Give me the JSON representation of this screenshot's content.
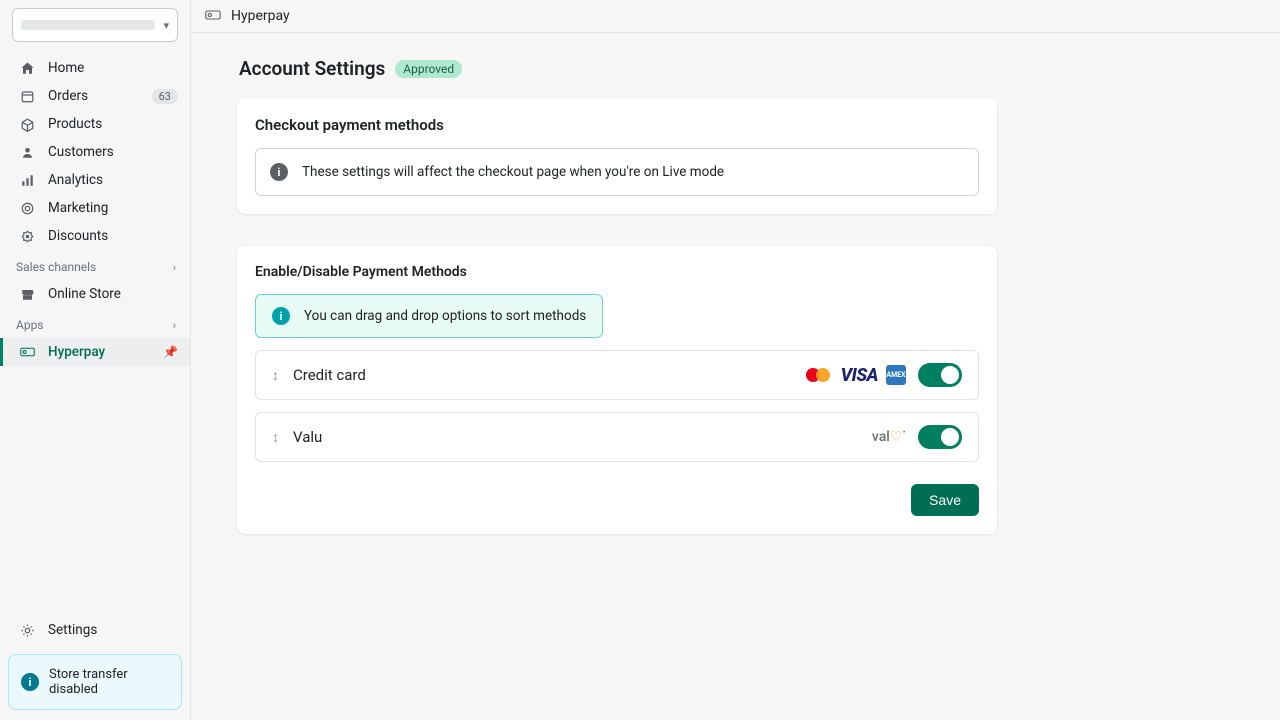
{
  "sidebar": {
    "items": [
      {
        "label": "Home"
      },
      {
        "label": "Orders",
        "badge": "63"
      },
      {
        "label": "Products"
      },
      {
        "label": "Customers"
      },
      {
        "label": "Analytics"
      },
      {
        "label": "Marketing"
      },
      {
        "label": "Discounts"
      }
    ],
    "sales_channels_label": "Sales channels",
    "online_store_label": "Online Store",
    "apps_label": "Apps",
    "app_item_label": "Hyperpay",
    "settings_label": "Settings",
    "transfer_banner": "Store transfer disabled"
  },
  "topbar": {
    "app_name": "Hyperpay"
  },
  "page": {
    "title": "Account Settings",
    "status": "Approved"
  },
  "card1": {
    "title": "Checkout payment methods",
    "banner": "These settings will affect the checkout page when you're on Live mode"
  },
  "card2": {
    "title": "Enable/Disable Payment Methods",
    "hint": "You can drag and drop options to sort methods",
    "methods": [
      {
        "name": "Credit card",
        "enabled": true,
        "brands": [
          "mastercard",
          "visa",
          "amex"
        ]
      },
      {
        "name": "Valu",
        "enabled": true,
        "brands": [
          "valu"
        ]
      }
    ],
    "save_label": "Save"
  }
}
